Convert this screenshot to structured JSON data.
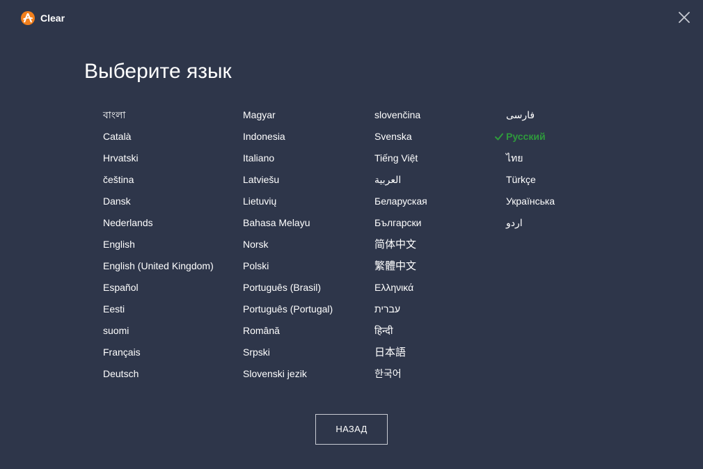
{
  "app": {
    "title": "Clear",
    "brand_color": "#f17f1c"
  },
  "icons": {
    "logo": "avast-logo-icon",
    "close": "close-icon",
    "check": "check-icon"
  },
  "heading": "Выберите язык",
  "selected_color": "#2e9a3c",
  "columns": [
    [
      "বাংলা",
      "Català",
      "Hrvatski",
      "čeština",
      "Dansk",
      "Nederlands",
      "English",
      "English (United Kingdom)",
      "Español",
      "Eesti",
      "suomi",
      "Français",
      "Deutsch"
    ],
    [
      "Magyar",
      "Indonesia",
      "Italiano",
      "Latviešu",
      "Lietuvių",
      "Bahasa Melayu",
      "Norsk",
      "Polski",
      "Português (Brasil)",
      "Português (Portugal)",
      "Română",
      "Srpski",
      "Slovenski jezik"
    ],
    [
      "slovenčina",
      "Svenska",
      "Tiếng Việt",
      "العربية",
      "Беларуская",
      "Български",
      "简体中文",
      "繁體中文",
      "Ελληνικά",
      "עברית",
      "हिन्दी",
      "日本語",
      "한국어"
    ],
    [
      "فارسی",
      "Русский",
      "ไทย",
      "Türkçe",
      "Українська",
      "اردو"
    ]
  ],
  "selected_language": "Русский",
  "back_button": "НАЗАД"
}
